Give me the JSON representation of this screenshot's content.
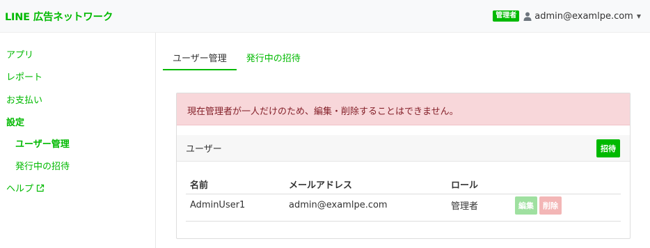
{
  "header": {
    "brand": "LINE 広告ネットワーク",
    "role_badge": "管理者",
    "user_email": "admin@examlpe.com",
    "user_icon": "user-icon",
    "caret_icon": "chevron-down-icon",
    "brand_color": "#00b900"
  },
  "sidebar": {
    "items": [
      {
        "label": "アプリ"
      },
      {
        "label": "レポート"
      },
      {
        "label": "お支払い"
      },
      {
        "label": "設定"
      },
      {
        "label": "ユーザー管理"
      },
      {
        "label": "発行中の招待"
      },
      {
        "label": "ヘルプ",
        "icon": "external-link-icon"
      }
    ]
  },
  "tabs": [
    {
      "label": "ユーザー管理",
      "active": true
    },
    {
      "label": "発行中の招待",
      "active": false
    }
  ],
  "alert": {
    "message": "現在管理者が一人だけのため、編集・削除することはできません。",
    "color": "#f8d7da"
  },
  "users_card": {
    "title": "ユーザー",
    "invite_label": "招待",
    "columns": [
      "名前",
      "メールアドレス",
      "ロール",
      ""
    ],
    "rows": [
      {
        "name": "AdminUser1",
        "email": "admin@examlpe.com",
        "role": "管理者",
        "edit_label": "編集",
        "delete_label": "削除",
        "edit_disabled": true,
        "delete_disabled": true
      }
    ]
  }
}
